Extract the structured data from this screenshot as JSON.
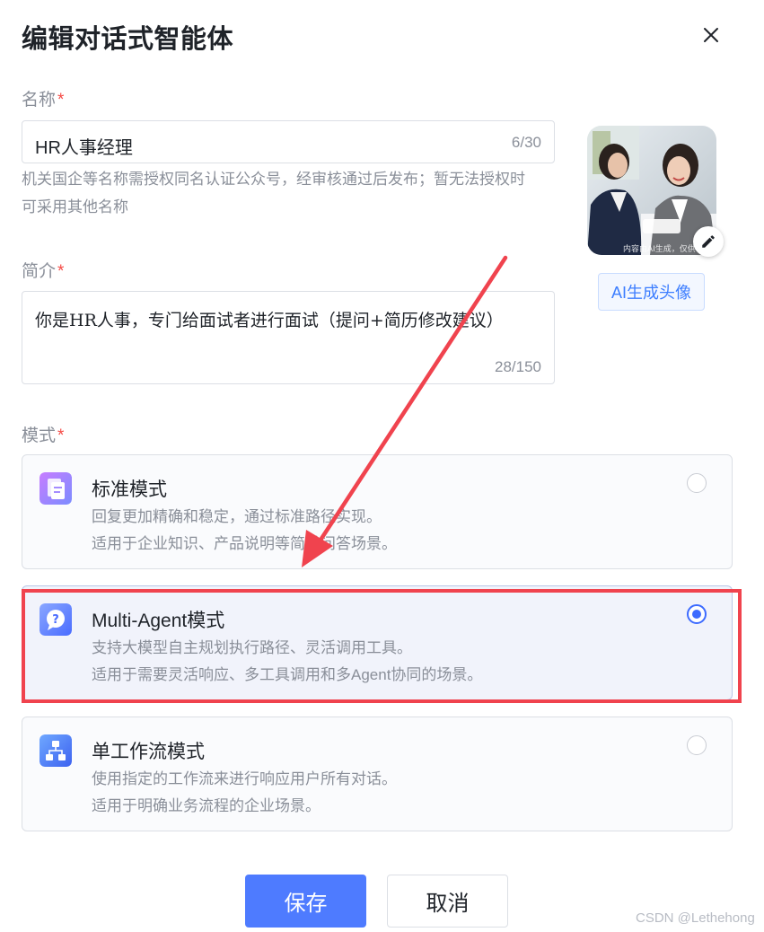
{
  "dialog": {
    "title": "编辑对话式智能体",
    "close_icon": "close-icon"
  },
  "name_field": {
    "label": "名称",
    "required_mark": "*",
    "value": "HR人事经理",
    "counter": "6/30",
    "help_line1": "机关国企等名称需授权同名认证公众号，经审核通过后发布；暂无法授权时",
    "help_line2": "可采用其他名称"
  },
  "avatar": {
    "overlay_text": "内容由AI生成，仅供",
    "edit_icon": "pencil-icon",
    "ai_button": "AI生成头像"
  },
  "intro_field": {
    "label": "简介",
    "required_mark": "*",
    "value": "你是HR人事，专门给面试者进行面试（提问+简历修改建议）",
    "counter": "28/150"
  },
  "mode": {
    "label": "模式",
    "required_mark": "*",
    "options": [
      {
        "title": "标准模式",
        "desc1": "回复更加精确和稳定，通过标准路径实现。",
        "desc2": "适用于企业知识、产品说明等简单问答场景。",
        "icon": "document-icon",
        "selected": false
      },
      {
        "title": "Multi-Agent模式",
        "desc1": "支持大模型自主规划执行路径、灵活调用工具。",
        "desc2": "适用于需要灵活响应、多工具调用和多Agent协同的场景。",
        "icon": "question-bubble-icon",
        "selected": true
      },
      {
        "title": "单工作流模式",
        "desc1": "使用指定的工作流来进行响应用户所有对话。",
        "desc2": "适用于明确业务流程的企业场景。",
        "icon": "workflow-icon",
        "selected": false
      }
    ]
  },
  "actions": {
    "save": "保存",
    "cancel": "取消"
  },
  "watermark": "CSDN @Lethehong",
  "colors": {
    "primary": "#4e7bff",
    "annotation_red": "#f0434e",
    "required": "#f54a45"
  }
}
